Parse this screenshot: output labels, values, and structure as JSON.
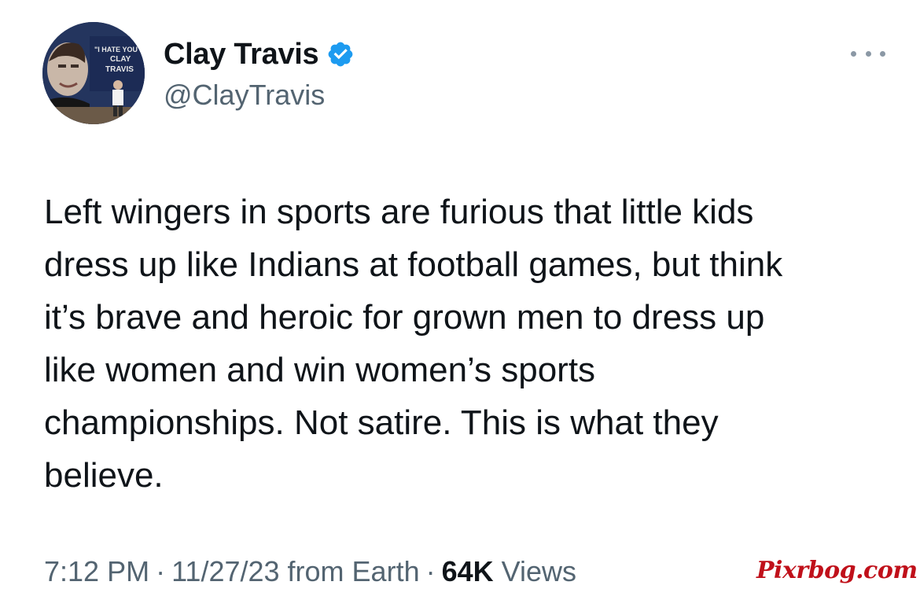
{
  "author": {
    "name": "Clay Travis",
    "handle": "@ClayTravis",
    "verified": true,
    "avatar_banner_text": "\"I HATE YOU CLAY TRAVIS\""
  },
  "tweet": {
    "lines": [
      "Left wingers in sports are furious that little kids",
      "dress up like Indians at football games, but think",
      "it’s brave and heroic for grown men to dress up",
      "like women and win women’s sports",
      "championships. Not satire. This is what they",
      "believe."
    ]
  },
  "meta": {
    "time": "7:12 PM",
    "separator": "·",
    "date": "11/27/23",
    "source": "from Earth",
    "views_count": "64K",
    "views_label": "Views"
  },
  "watermark": "Pixrbog.com",
  "icons": {
    "verified": "verified-badge-icon",
    "more": "more-options-icon"
  },
  "colors": {
    "verified_blue": "#1d9bf0",
    "text_primary": "#0f1419",
    "text_secondary": "#536471",
    "watermark_red": "#c0101a"
  }
}
